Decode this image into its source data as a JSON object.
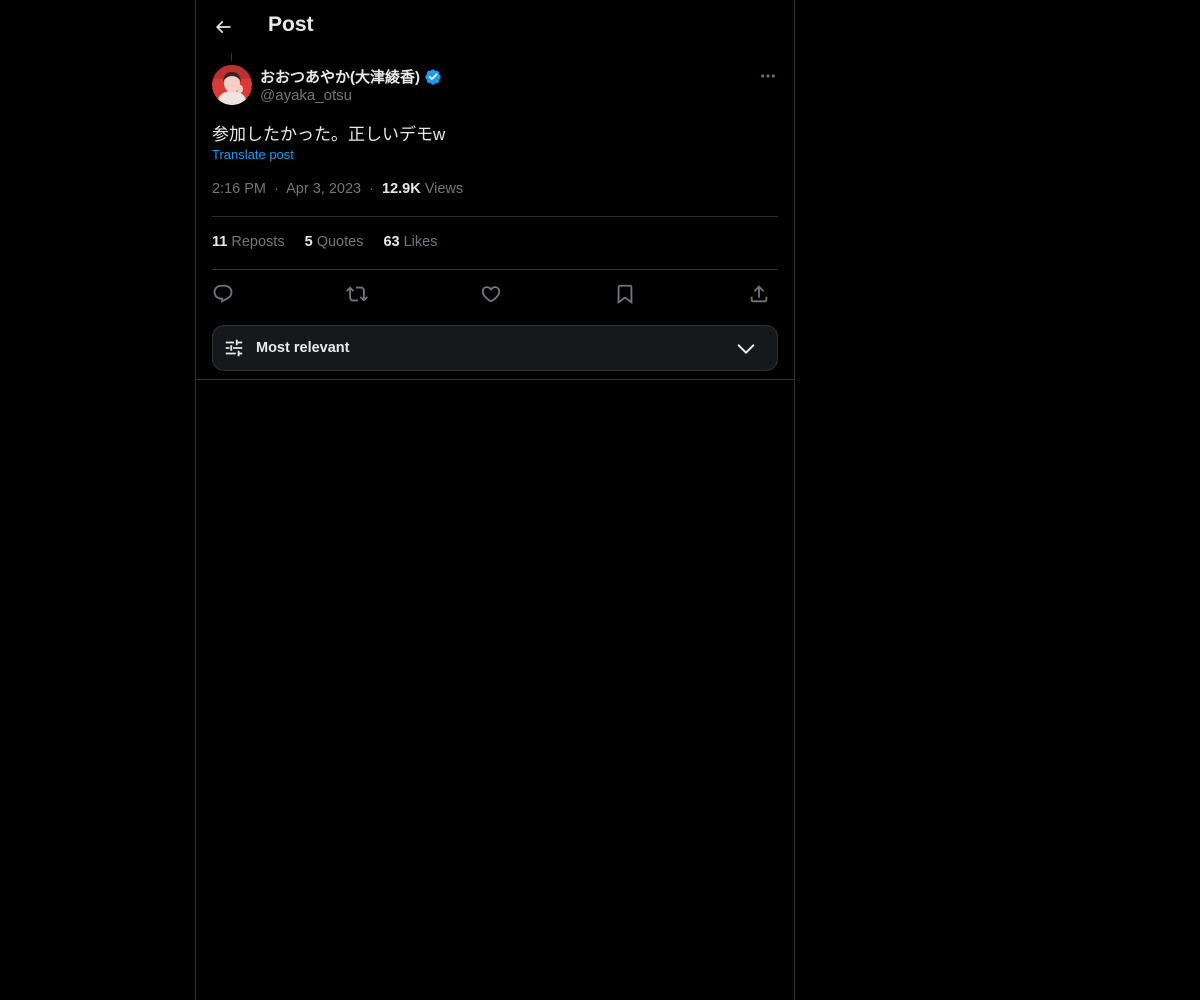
{
  "header": {
    "title": "Post",
    "back_icon": "arrow-left-icon"
  },
  "post": {
    "author": {
      "name": "おおつあやか(大津綾香)",
      "handle": "@ayaka_otsu",
      "verified": true,
      "verified_color": "#1d9bf0",
      "avatar_icon": "avatar-photo"
    },
    "text": "参加したかった。正しいデモw",
    "translate_label": "Translate post",
    "time": "2:16 PM",
    "separator": "·",
    "date": "Apr 3, 2023",
    "views_count": "12.9K",
    "views_label": "Views"
  },
  "stats": {
    "reposts": {
      "count": "11",
      "label": "Reposts"
    },
    "quotes": {
      "count": "5",
      "label": "Quotes"
    },
    "likes": {
      "count": "63",
      "label": "Likes"
    }
  },
  "actions": [
    {
      "name": "reply",
      "icon": "reply-icon"
    },
    {
      "name": "repost",
      "icon": "repost-icon"
    },
    {
      "name": "like",
      "icon": "heart-icon"
    },
    {
      "name": "bookmark",
      "icon": "bookmark-icon"
    },
    {
      "name": "share",
      "icon": "share-icon"
    }
  ],
  "replies_sort": {
    "label": "Most relevant",
    "icon": "sliders-icon",
    "chevron": "chevron-down-icon"
  },
  "colors": {
    "background": "#000000",
    "text": "#e7e9ea",
    "muted": "#71767b",
    "accent": "#1d9bf0",
    "border": "#2f3336"
  }
}
